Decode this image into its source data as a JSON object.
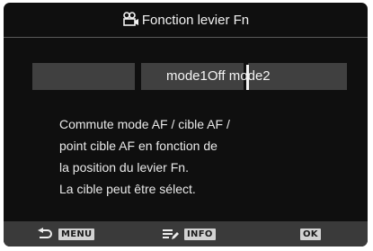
{
  "title": {
    "icon": "movie-camera-icon",
    "text": "Fonction levier Fn"
  },
  "options": {
    "current_text": "mode1Off mode2"
  },
  "description": {
    "lines": [
      "Commute mode AF / cible AF /",
      "point cible AF en fonction de",
      "la position du levier Fn.",
      "La cible peut être sélect."
    ]
  },
  "footer": {
    "back": {
      "icon": "back-arrow-icon",
      "key": "MENU"
    },
    "info": {
      "icon": "list-edit-icon",
      "key": "INFO"
    },
    "ok": {
      "key": "OK"
    }
  },
  "colors": {
    "background": "#0f0f0f",
    "selector_gray": "#404040",
    "footer_gray": "#3a3a3a",
    "text": "#f2f2f2"
  }
}
